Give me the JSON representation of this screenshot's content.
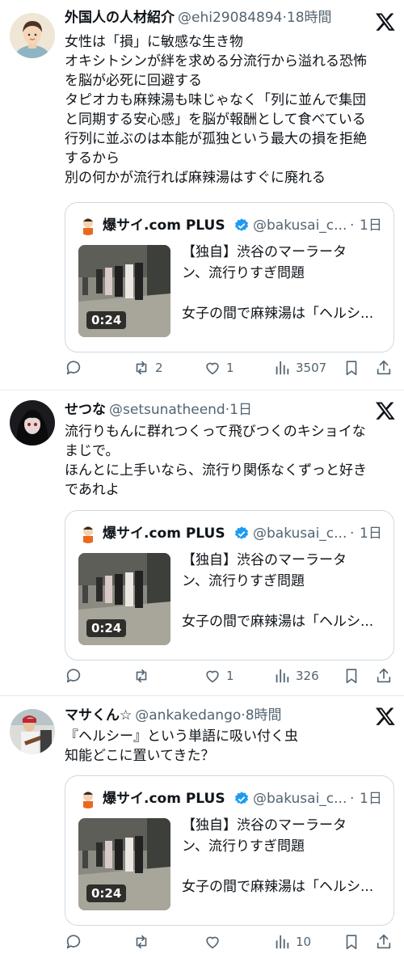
{
  "tweets": [
    {
      "author_name": "外国人の人材紹介",
      "handle": "@ehi29084894",
      "separator": "·",
      "time": "18時間",
      "avatar_icon": "illustrated-person-avatar",
      "text_lines": [
        "女性は「損」に敏感な生き物",
        "オキシトシンが絆を求める分流行から溢れる恐怖",
        "を脳が必死に回避する",
        "タピオカも麻辣湯も味じゃなく「列に並んで集団",
        "と同期する安心感」を脳が報酬として食べている",
        "行列に並ぶのは本能が孤独という最大の損を拒絶",
        "するから",
        "別の何かが流行れば麻辣湯はすぐに廃れる"
      ],
      "quote": {
        "name": "爆サイ.com PLUS",
        "handle": "@bakusai_c...",
        "separator": "·",
        "time": "1日",
        "duration": "0:24",
        "title_lines": [
          "【独自】渋谷のマーラータ",
          "ン、流行りすぎ問題"
        ],
        "desc": "女子の間で麻辣湯は「ヘルシ..."
      },
      "actions": {
        "reply": "",
        "retweet": "2",
        "like": "1",
        "views": "3507"
      }
    },
    {
      "author_name": "せつな",
      "handle": "@setsunatheend",
      "separator": "·",
      "time": "1日",
      "avatar_icon": "dark-hair-character-avatar",
      "text_lines": [
        "流行りもんに群れつくって飛びつくのキショイな",
        "まじで。",
        "ほんとに上手いなら、流行り関係なくずっと好き",
        "であれよ"
      ],
      "quote": {
        "name": "爆サイ.com PLUS",
        "handle": "@bakusai_c...",
        "separator": "·",
        "time": "1日",
        "duration": "0:24",
        "title_lines": [
          "【独自】渋谷のマーラータ",
          "ン、流行りすぎ問題"
        ],
        "desc": "女子の間で麻辣湯は「ヘルシ..."
      },
      "actions": {
        "reply": "",
        "retweet": "",
        "like": "1",
        "views": "326"
      }
    },
    {
      "author_name": "マサくん☆",
      "handle": "@ankakedango",
      "separator": "·",
      "time": "8時間",
      "avatar_icon": "person-with-guitar-avatar",
      "text_lines": [
        "『ヘルシー』という単語に吸い付く虫",
        "知能どこに置いてきた？"
      ],
      "quote": {
        "name": "爆サイ.com PLUS",
        "handle": "@bakusai_c...",
        "separator": "·",
        "time": "1日",
        "duration": "0:24",
        "title_lines": [
          "【独自】渋谷のマーラータ",
          "ン、流行りすぎ問題"
        ],
        "desc": "女子の間で麻辣湯は「ヘルシ..."
      },
      "actions": {
        "reply": "",
        "retweet": "",
        "like": "",
        "views": "10"
      }
    }
  ],
  "colors": {
    "text": "#0f1419",
    "secondary": "#536471",
    "border": "#cfd9de",
    "verified": "#1d9bf0"
  }
}
